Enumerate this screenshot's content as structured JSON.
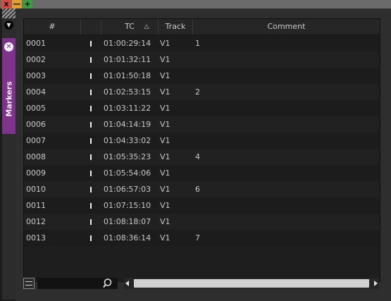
{
  "window": {
    "title_buttons": [
      "x",
      "—",
      "+"
    ],
    "close_color": "#d34c3f",
    "min_color": "#e0a030",
    "max_color": "#3f9a45"
  },
  "side": {
    "dropdown_glyph": "▼",
    "tab_label": "Markers",
    "tab_close_glyph": "✕",
    "tab_color": "#7f338c"
  },
  "table": {
    "headers": {
      "num": "#",
      "color": "",
      "tc": "TC",
      "track": "Track",
      "comment": "Comment"
    },
    "sort_column": "tc",
    "rows": [
      {
        "num": "0001",
        "tc": "01:00:29:14",
        "track": "V1",
        "comment": "1"
      },
      {
        "num": "0002",
        "tc": "01:01:32:11",
        "track": "V1",
        "comment": ""
      },
      {
        "num": "0003",
        "tc": "01:01:50:18",
        "track": "V1",
        "comment": ""
      },
      {
        "num": "0004",
        "tc": "01:02:53:15",
        "track": "V1",
        "comment": "2"
      },
      {
        "num": "0005",
        "tc": "01:03:11:22",
        "track": "V1",
        "comment": ""
      },
      {
        "num": "0006",
        "tc": "01:04:14:19",
        "track": "V1",
        "comment": ""
      },
      {
        "num": "0007",
        "tc": "01:04:33:02",
        "track": "V1",
        "comment": ""
      },
      {
        "num": "0008",
        "tc": "01:05:35:23",
        "track": "V1",
        "comment": "4"
      },
      {
        "num": "0009",
        "tc": "01:05:54:06",
        "track": "V1",
        "comment": ""
      },
      {
        "num": "0010",
        "tc": "01:06:57:03",
        "track": "V1",
        "comment": "6"
      },
      {
        "num": "0011",
        "tc": "01:07:15:10",
        "track": "V1",
        "comment": ""
      },
      {
        "num": "0012",
        "tc": "01:08:18:07",
        "track": "V1",
        "comment": ""
      },
      {
        "num": "0013",
        "tc": "01:08:36:14",
        "track": "V1",
        "comment": "7"
      }
    ]
  },
  "bottom": {
    "search_value": "",
    "icons": [
      "list-view-icon",
      "search-icon",
      "scroll-left-icon",
      "scroll-right-icon"
    ]
  }
}
